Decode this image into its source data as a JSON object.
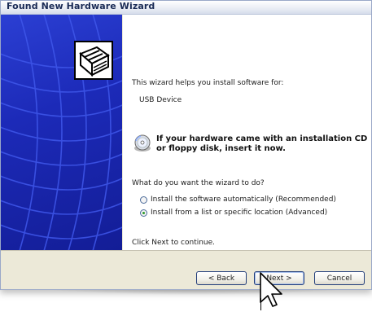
{
  "window": {
    "title": "Found New Hardware Wizard"
  },
  "content": {
    "intro": "This wizard helps you install software for:",
    "device_name": "USB Device",
    "cd_notice_line1": "If your hardware came with an installation CD",
    "cd_notice_line2": "or floppy disk, insert it now.",
    "question": "What do you want the wizard to do?",
    "options": [
      {
        "label": "Install the software automatically (Recommended)",
        "selected": false
      },
      {
        "label": "Install from a list or specific location (Advanced)",
        "selected": true
      }
    ],
    "instruction": "Click Next to continue."
  },
  "buttons": {
    "back": "< Back",
    "next": "Next >",
    "cancel": "Cancel"
  },
  "colors": {
    "left_panel": "#1c2ab8",
    "title_text": "#1a2b55",
    "radio_selected": "#2b9a2b"
  },
  "icons": {
    "wizard_graphic": "hardware-card-icon",
    "cd": "cd-icon",
    "cursor": "mouse-pointer-icon"
  }
}
